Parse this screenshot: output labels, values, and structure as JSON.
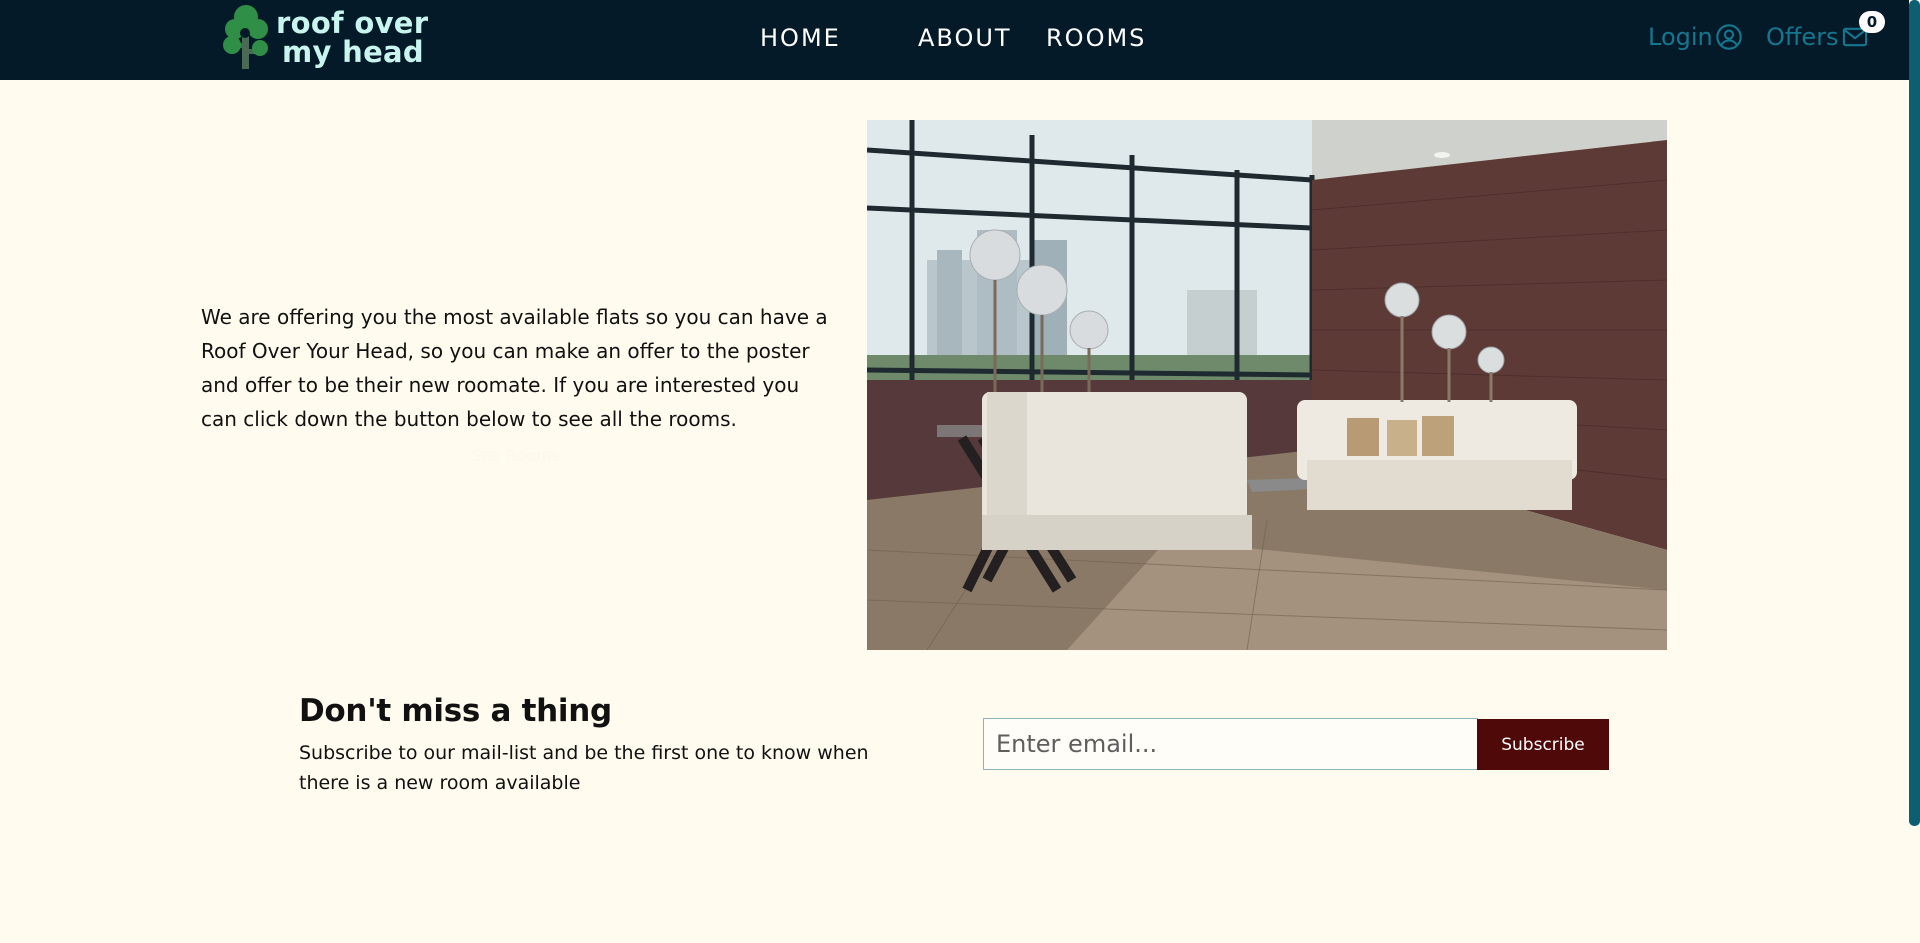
{
  "brand": {
    "logo_line1": "roof over",
    "logo_line2": "my head",
    "logo_text_color": "#c9f5ef",
    "tree_color": "#2f8f46"
  },
  "nav": {
    "links": [
      "HOME",
      "ABOUT",
      "ROOMS"
    ],
    "login_label": "Login",
    "offers_label": "Offers",
    "offers_count": "0",
    "background": "#051a29",
    "accent": "#14778f"
  },
  "hero": {
    "description": "We are offering you the most available flats so you can have a Roof Over Your Head, so you can make an offer to the poster and offer to be their new roomate. If you are interested you can click down the button below to see all the rooms.",
    "button_label": "See Rooms"
  },
  "subscribe": {
    "title": "Don't miss a thing",
    "description": "Subscribe to our mail-list and be the first one to know when there is a new room available",
    "email_placeholder": "Enter email...",
    "button_label": "Subscribe",
    "button_color": "#4f0909"
  },
  "icons": {
    "login": "user-circle-icon",
    "offers": "envelope-icon"
  }
}
